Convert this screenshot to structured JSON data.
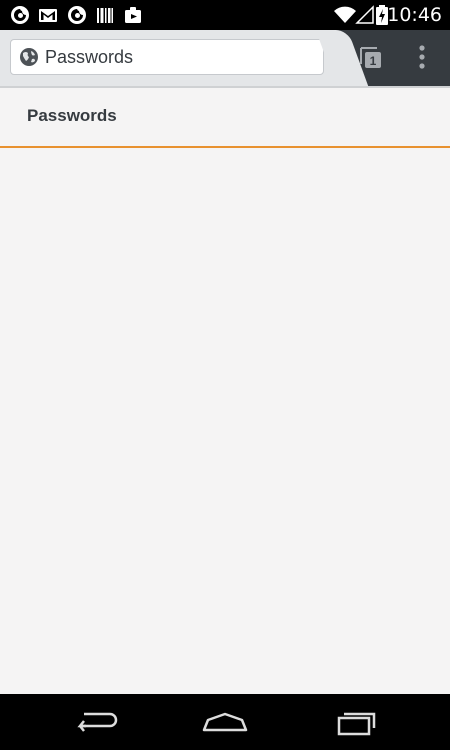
{
  "status_bar": {
    "time": "10:46",
    "notification_icons": [
      "firefox-icon",
      "gmail-icon",
      "firefox-icon",
      "barcode-icon",
      "media-icon"
    ],
    "system_icons": [
      "wifi-icon",
      "cell-signal-icon",
      "battery-charging-icon"
    ]
  },
  "toolbar": {
    "url_text": "Passwords",
    "globe_icon": "globe-icon",
    "tab_count": "1",
    "menu_icon": "overflow-menu-icon"
  },
  "page": {
    "title": "Passwords"
  },
  "nav_bar": {
    "icons": [
      "back-icon",
      "home-icon",
      "recents-icon"
    ]
  },
  "colors": {
    "toolbar_dark": "#363b40",
    "toolbar_light": "#e4e6e8",
    "accent": "#e8912f",
    "background": "#f5f4f4"
  }
}
